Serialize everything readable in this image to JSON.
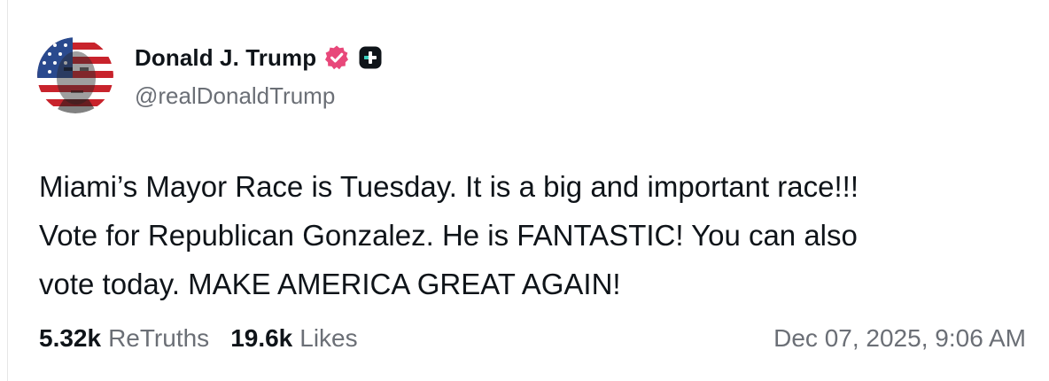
{
  "post": {
    "author": {
      "display_name": "Donald J. Trump",
      "handle": "@realDonaldTrump",
      "verified_badge_icon": "verified-badge-icon",
      "plus_badge_icon": "plus-badge-icon",
      "avatar": "avatar"
    },
    "body_lines": [
      "Miami’s Mayor Race is Tuesday. It is a big and important race!!!",
      "Vote for Republican Gonzalez. He is FANTASTIC! You can also",
      "vote today. MAKE AMERICA GREAT AGAIN!"
    ],
    "stats": {
      "retruths_count": "5.32k",
      "retruths_label": "ReTruths",
      "likes_count": "19.6k",
      "likes_label": "Likes"
    },
    "timestamp": "Dec 07, 2025, 9:06 AM"
  },
  "colors": {
    "verified_badge": "#e8487a",
    "plus_badge": "#0f1419",
    "plus_accent": "#39d2c0",
    "secondary_text": "#6b6f76",
    "primary_text": "#0f1419"
  }
}
